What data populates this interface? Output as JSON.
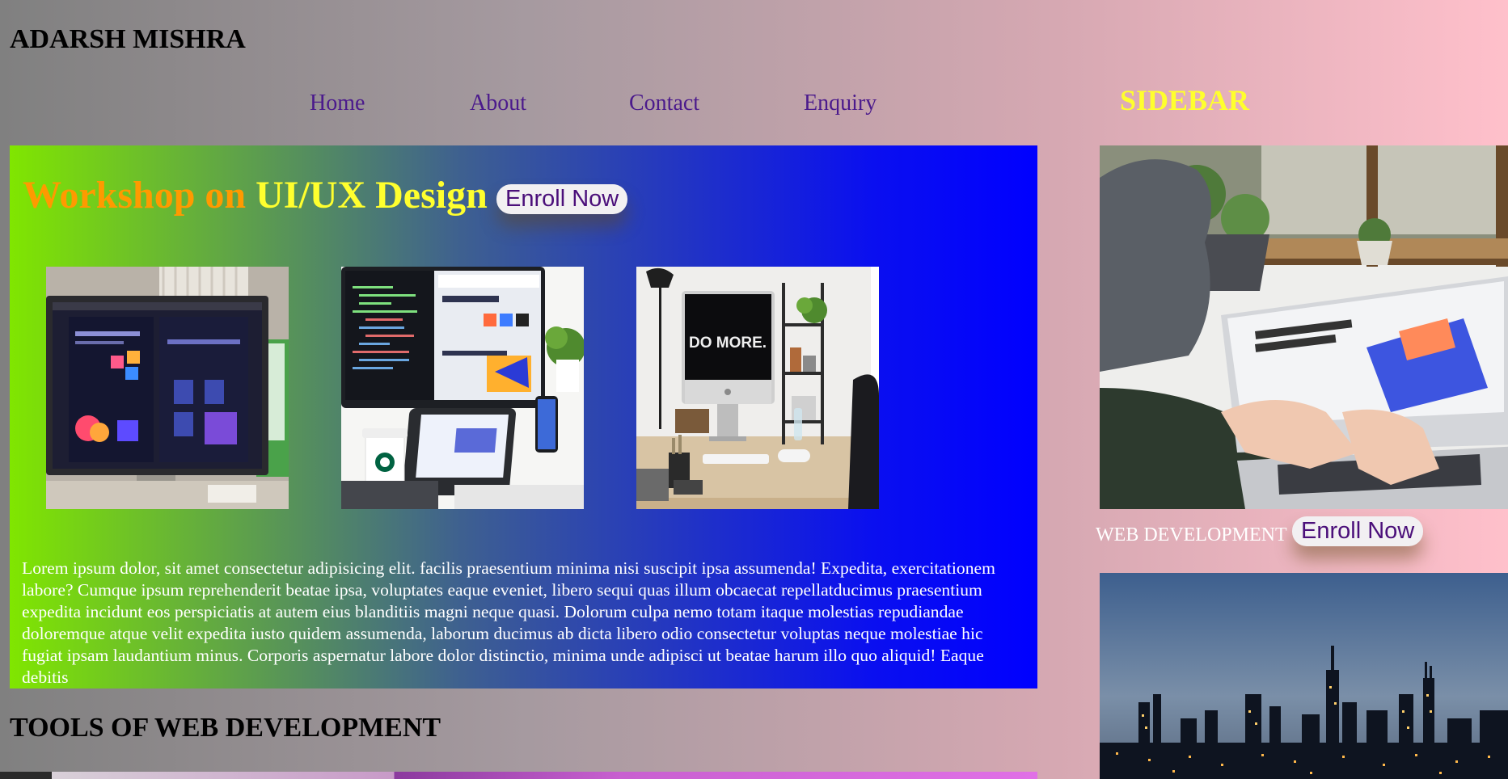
{
  "header": {
    "title": "ADARSH MISHRA"
  },
  "nav": {
    "items": [
      {
        "label": "Home"
      },
      {
        "label": "About"
      },
      {
        "label": "Contact"
      },
      {
        "label": "Enquiry"
      }
    ]
  },
  "sidebar": {
    "title": "SIDEBAR",
    "caption": "WEB DEVELOPMENT",
    "enroll_label": "Enroll Now"
  },
  "main": {
    "headline_part1": "Workshop on",
    "headline_part2": "UI/UX Design",
    "enroll_label": "Enroll Now",
    "body_text": "Lorem ipsum dolor, sit amet consectetur adipisicing elit. facilis praesentium minima nisi suscipit ipsa assumenda! Expedita, exercitationem labore? Cumque ipsum reprehenderit beatae ipsa, voluptates eaque eveniet, libero sequi quas illum obcaecat repellatducimus praesentium expedita incidunt eos perspiciatis at autem eius blanditiis magni neque quasi. Dolorum culpa nemo totam itaque molestias repudiandae doloremque atque velit expedita iusto quidem assumenda, laborum ducimus ab dicta libero odio consectetur voluptas neque molestiae hic fugiat ipsam laudantium minus. Corporis aspernatur labore dolor distinctio, minima unde adipisci ut beatae harum illo quo aliquid! Eaque debitis",
    "photo_text": "DO MORE."
  },
  "tools": {
    "heading": "TOOLS OF WEB DEVELOPMENT"
  },
  "colors": {
    "nav_link": "#4b1a8c",
    "sidebar_title": "#ffff2e",
    "headline_orange": "#ff9a00",
    "headline_yellow": "#ffff2e",
    "button_text": "#4b0f7a"
  }
}
